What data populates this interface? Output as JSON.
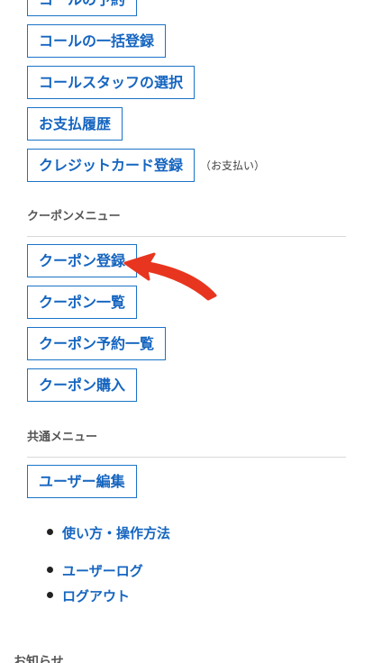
{
  "top_buttons": [
    {
      "label": "コールの予約"
    },
    {
      "label": "コールの一括登録"
    },
    {
      "label": "コールスタッフの選択"
    },
    {
      "label": "お支払履歴"
    },
    {
      "label": "クレジットカード登録",
      "note": "（お支払い）"
    }
  ],
  "coupon_menu": {
    "title": "クーポンメニュー",
    "buttons": [
      {
        "label": "クーポン登録"
      },
      {
        "label": "クーポン一覧"
      },
      {
        "label": "クーポン予約一覧"
      },
      {
        "label": "クーポン購入"
      }
    ]
  },
  "common_menu": {
    "title": "共通メニュー",
    "buttons": [
      {
        "label": "ユーザー編集"
      }
    ],
    "links": [
      {
        "label": "使い方・操作方法"
      },
      {
        "label": "ユーザーログ"
      },
      {
        "label": "ログアウト"
      }
    ]
  },
  "news": {
    "title": "お知らせ"
  },
  "colors": {
    "link": "#1565c0",
    "border": "#1a73c8",
    "arrow": "#e8351f"
  },
  "annotation": {
    "arrow_icon": "red-arrow-icon"
  }
}
